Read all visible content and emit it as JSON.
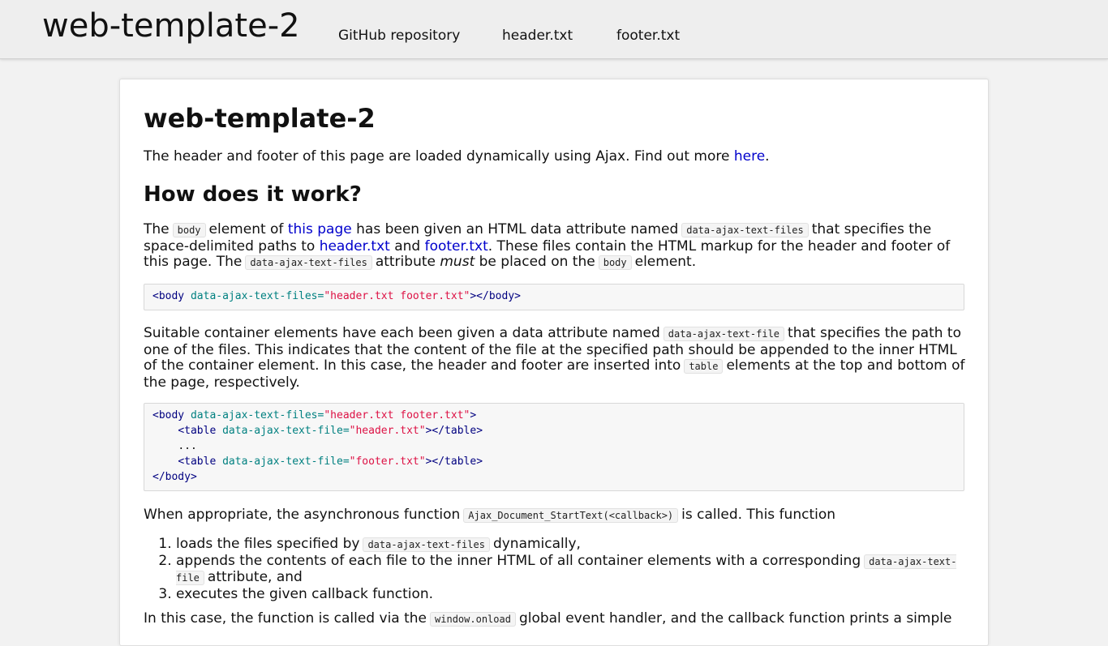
{
  "header": {
    "site_title": "web-template-2",
    "nav": [
      "GitHub repository",
      "header.txt",
      "footer.txt"
    ]
  },
  "main": {
    "title": "web-template-2",
    "intro": {
      "text": "The header and footer of this page are loaded dynamically using Ajax. Find out more ",
      "link": "here",
      "end": "."
    },
    "section_title": "How does it work?",
    "para1": {
      "t1": "The",
      "code1": "body",
      "t2": "element of",
      "link1": "this page",
      "t3": "has been given an HTML data attribute named",
      "code2": "data-ajax-text-files",
      "t4": "that specifies the space-delimited paths to",
      "link2": "header.txt",
      "t5": "and",
      "link3": "footer.txt",
      "t6": ". These files contain the HTML markup for the header and footer of this page. The",
      "code3": "data-ajax-text-files",
      "t7": "attribute",
      "em": "must",
      "t8": "be placed on the",
      "code4": "body",
      "t9": "element."
    },
    "code_block1": {
      "open": "<body",
      "attr": "data-ajax-text-files",
      "eq": "=",
      "value": "\"header.txt footer.txt\"",
      "close": "></body>"
    },
    "para2": {
      "t1": "Suitable container elements have each been given a data attribute named",
      "code1": "data-ajax-text-file",
      "t2": "that specifies the path to one of the files. This indicates that the content of the file at the specified path should be appended to the inner HTML of the container element. In this case, the header and footer are inserted into",
      "code2": "table",
      "t3": "elements at the top and bottom of the page, respectively."
    },
    "code_block2": {
      "l1_open": "<body",
      "l1_attr": "data-ajax-text-files",
      "l1_eq": "=",
      "l1_val": "\"header.txt footer.txt\"",
      "l1_close": ">",
      "l2_open": "<table",
      "l2_attr": "data-ajax-text-file",
      "l2_eq": "=",
      "l2_val": "\"header.txt\"",
      "l2_close": "></table>",
      "l3": "...",
      "l4_open": "<table",
      "l4_attr": "data-ajax-text-file",
      "l4_eq": "=",
      "l4_val": "\"footer.txt\"",
      "l4_close": "></table>",
      "l5": "</body>"
    },
    "para3": {
      "t1": "When appropriate, the asynchronous function",
      "code1": "Ajax_Document_StartText(<callback>)",
      "t2": "is called. This function"
    },
    "list": {
      "item1_t": "loads the files specified by",
      "item1_code": "data-ajax-text-files",
      "item1_end": "dynamically,",
      "item2_t": "appends the contents of each file to the inner HTML of all container elements with a corresponding",
      "item2_code": "data-ajax-text-file",
      "item2_end": "attribute, and",
      "item3": "executes the given callback function."
    },
    "para4": {
      "t1": "In this case, the function is called via the",
      "code1": "window.onload",
      "t2": "global event handler, and the callback function prints a simple"
    }
  }
}
